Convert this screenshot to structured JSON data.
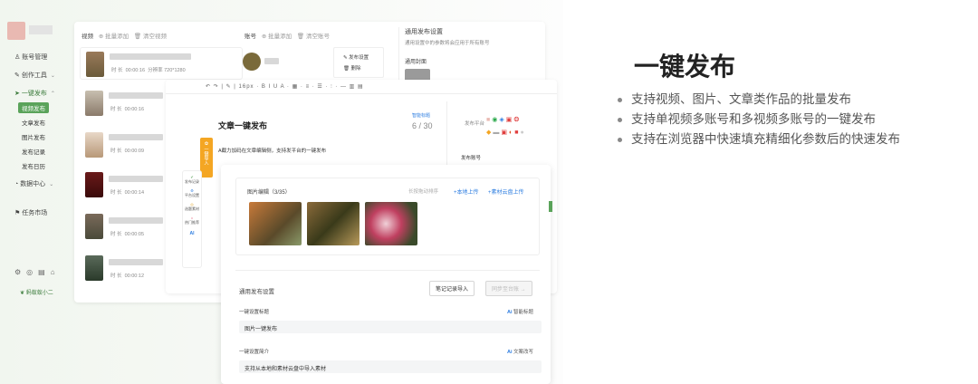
{
  "sidebar": {
    "items": [
      {
        "label": "账号管理",
        "icon": "user-icon"
      },
      {
        "label": "创作工具",
        "icon": "tool-icon"
      },
      {
        "label": "一键发布",
        "icon": "send-icon"
      },
      {
        "label": "数据中心",
        "icon": "chart-icon"
      },
      {
        "label": "任务市场",
        "icon": "flag-icon"
      }
    ],
    "sub_items": [
      "视频发布",
      "文章发布",
      "图片发布",
      "发布记录",
      "发布日历"
    ],
    "brand": "蚁小二"
  },
  "video_panel": {
    "title": "视频",
    "bulk_add": "批量添加",
    "clear": "清空视频",
    "rows": [
      {
        "duration": "00:00:16",
        "res_label": "分辨率",
        "resolution": "720*1280"
      },
      {
        "duration": "00:00:16"
      },
      {
        "duration": "00:00:09"
      },
      {
        "duration": "00:00:14"
      },
      {
        "duration": "00:00:05"
      },
      {
        "duration": "00:00:12"
      }
    ],
    "time_label": "时 长"
  },
  "account_panel": {
    "title": "账号",
    "bulk_add": "批量添加",
    "clear": "清空账号",
    "publish_settings": "发布设置",
    "delete": "删除"
  },
  "general_settings": {
    "title": "通用发布设置",
    "desc": "通用设置中的参数将会应用于所有账号",
    "cover": "通用封面"
  },
  "article": {
    "title": "文章一键发布",
    "counter": "6 / 30",
    "smart_title": "智能标题",
    "body": "A截力加码在文章编辑侧，支持发平台的一键发布",
    "toolbar": "16px",
    "publish_platform": "发布平台",
    "publish_account": "发布账号",
    "side_tools": [
      "发布记录",
      "平台设置",
      "选题素材",
      "热门推荐",
      "AI"
    ],
    "orange_tab": "一键导入"
  },
  "images": {
    "title": "图片编辑（3/35）",
    "sort": "长按拖动排序",
    "local_upload": "+本地上传",
    "cloud_upload": "+素材云盘上传"
  },
  "general_publish": {
    "title": "通用发布设置",
    "import_btn": "笔记记录导入",
    "sync_btn": "同步至台账 →",
    "title_label": "一键设置标题",
    "title_ai": "智能标题",
    "title_value": "图片一键发布",
    "intro_label": "一键设置简介",
    "intro_ai": "文案改写",
    "intro_value": "支持从本地和素材云盘中导入素材"
  },
  "marketing": {
    "heading": "一键发布",
    "bullets": [
      "支持视频、图片、文章类作品的批量发布",
      "支持单视频多账号和多视频多账号的一键发布",
      "支持在浏览器中快速填充精细化参数后的快速发布"
    ]
  },
  "colors": {
    "accent": "#5aa35a",
    "link": "#2d7de0",
    "orange": "#f4a623"
  }
}
